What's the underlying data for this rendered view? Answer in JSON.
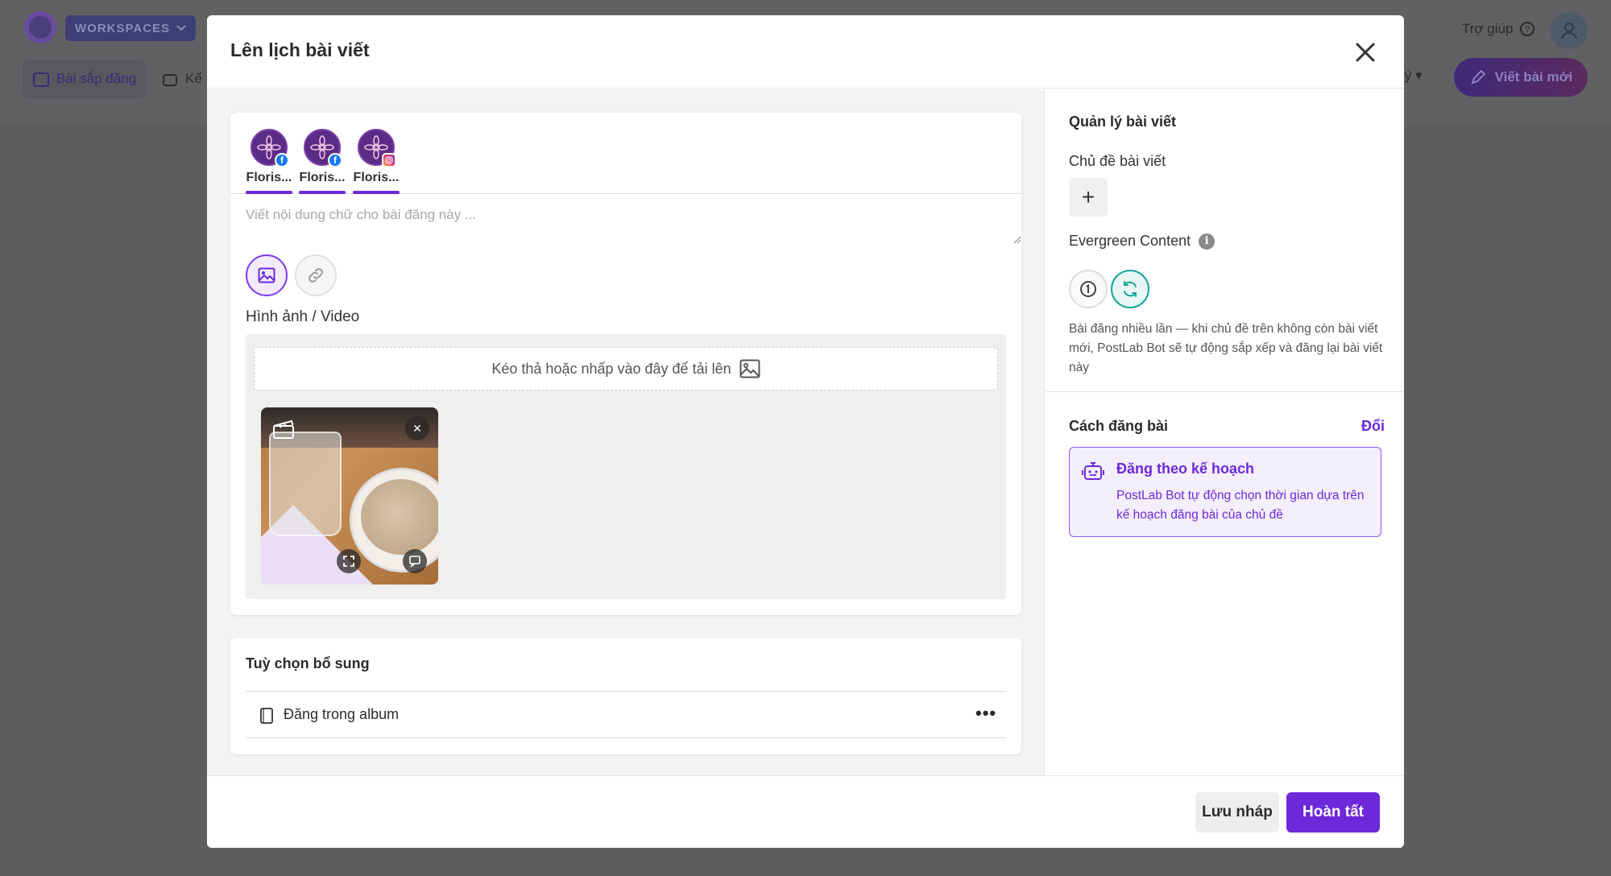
{
  "background": {
    "workspaces_label": "WORKSPACES",
    "tab_scheduled": "Bài sắp đăng",
    "tab_plan": "Kế",
    "help_label": "Trợ giúp",
    "manage_partial": "lý",
    "new_post_label": "Viết bài mới"
  },
  "modal": {
    "title": "Lên lịch bài viết",
    "accounts": [
      {
        "name": "Floris...",
        "network": "facebook"
      },
      {
        "name": "Floris...",
        "network": "facebook"
      },
      {
        "name": "Floris...",
        "network": "instagram"
      }
    ],
    "composer_placeholder": "Viết nội dung chữ cho bài đăng này ...",
    "media_label": "Hình ảnh / Video",
    "dropzone_label": "Kéo thả hoặc nhấp vào đây để tải lên",
    "extra_options_title": "Tuỳ chọn bổ sung",
    "album_label": "Đăng trong album",
    "more_label": "•••"
  },
  "right_panel": {
    "title": "Quản lý bài viết",
    "topic_label": "Chủ đề bài viết",
    "add_topic_symbol": "+",
    "evergreen_label": "Evergreen Content",
    "evergreen_description": "Bài đăng nhiều lần — khi chủ đề trên không còn bài viết mới, PostLab Bot sẽ tự động sắp xếp và đăng lại bài viết này",
    "method_title": "Cách đăng bài",
    "method_change": "Đổi",
    "method_name": "Đăng theo kế hoạch",
    "method_description": "PostLab Bot tự động chọn thời gian dựa trên kế hoạch đăng bài của chủ đề"
  },
  "footer": {
    "save_draft": "Lưu nháp",
    "finish": "Hoàn tất"
  },
  "colors": {
    "accent": "#6d28d9",
    "evergreen_active": "#16a39a",
    "facebook": "#1877f2"
  }
}
